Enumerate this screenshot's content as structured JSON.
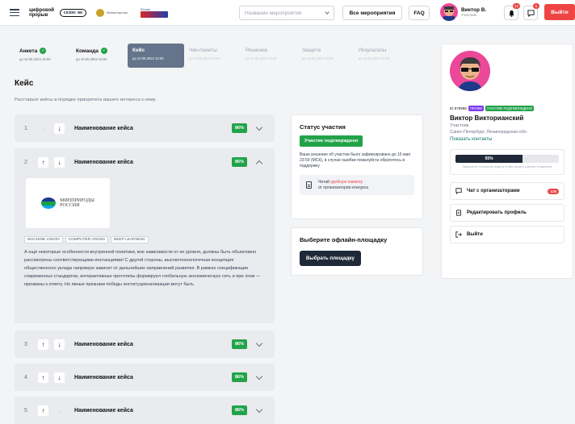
{
  "header": {
    "logo_text_1": "цифровой",
    "logo_text_2": "прорыв",
    "season_label": "сезон: ии",
    "partner_1_text": "Министерство",
    "partner_2_text": "Россия",
    "event_select_placeholder": "Название мероприятия",
    "all_events_label": "Все мероприятия",
    "faq_label": "FAQ",
    "user_name": "Виктор В.",
    "user_role": "Участник",
    "bell_count": "12",
    "chat_count": "5",
    "logout_label": "Выйти"
  },
  "steps": [
    {
      "title": "Анкета",
      "date": "до 10.05.2024 10:00",
      "state": "done"
    },
    {
      "title": "Команда",
      "date": "до 10.05.2024 10:00",
      "state": "done"
    },
    {
      "title": "Кейс",
      "date": "до 10.05.2024 10:00",
      "state": "active"
    },
    {
      "title": "Чек-поинты",
      "date": "до 10.05.2024 10:00",
      "state": "future"
    },
    {
      "title": "Решение",
      "date": "до 10.05.2024 10:00",
      "state": "future"
    },
    {
      "title": "Защита",
      "date": "до 10.05.2024 10:00",
      "state": "future"
    },
    {
      "title": "Результаты",
      "date": "до 10.05.2024 10:00",
      "state": "future"
    }
  ],
  "page": {
    "title": "Кейс",
    "subtitle": "Расставьте кейсы в порядке приоритета вашего интереса к нему"
  },
  "cases": [
    {
      "num": "1",
      "name": "Наименование кейса",
      "pct": "86%",
      "up_enabled": false,
      "down_enabled": true
    },
    {
      "num": "2",
      "name": "Наименование кейса",
      "pct": "86%",
      "up_enabled": true,
      "down_enabled": true,
      "expanded": true,
      "org_logo_text_1": "МИНПРИРОДЫ",
      "org_logo_text_2": "РОССИИ",
      "tags": [
        "MACHINE VISION",
        "COMPUTER VISION",
        "DEEP LEARNING"
      ],
      "description": "А ещё некоторые особенности внутренней политики, вне зависимости от их уровня, должны быть объективно рассмотрены соответствующими инстанциями! С другой стороны, высокотехнологичная концепция общественного уклада напрямую зависит от дальнейших направлений развития. В рамках спецификации современных стандартов, интерактивные прототипы формируют глобальную экономическую сеть и при этом — призваны к ответу. Но явные признаки победы институционализации могут быть"
    },
    {
      "num": "3",
      "name": "Наименование кейса",
      "pct": "86%",
      "up_enabled": true,
      "down_enabled": true
    },
    {
      "num": "4",
      "name": "Наименование кейса",
      "pct": "86%",
      "up_enabled": true,
      "down_enabled": true
    },
    {
      "num": "5",
      "name": "Наименование кейса",
      "pct": "86%",
      "up_enabled": true,
      "down_enabled": false
    }
  ],
  "status_card": {
    "title": "Статус участия",
    "confirm_label": "Участие подтверждено",
    "note": "Ваше решение об участии было зафиксировано до 16 мая 23:59 (МСК), в случае ошибки пожалуйста обратитесь в поддержку",
    "memo_prefix": "Читай",
    "memo_link": "удобную памятку",
    "memo_suffix": "от организаторов конкурса"
  },
  "venue_card": {
    "title": "Выберите офлайн-площадку",
    "button_label": "Выбрать площадку"
  },
  "profile": {
    "id_label": "ID 878998",
    "badge_pro": "ПРОФИ",
    "badge_confirmed": "УЧАСТИЕ ПОДТВЕРЖДЕНО",
    "name": "Виктор Викторианский",
    "role": "Участник",
    "city": "Санкт-Петербург, Ленинградская обл.",
    "contacts_label": "Показать контакты",
    "progress_label": "65%",
    "progress_value": 0.65,
    "progress_note": "Заполните полностью анкету чтобы начать участие в хакатоне",
    "menu": [
      {
        "label": "Чат с организаторами",
        "count": "125"
      },
      {
        "label": "Редактировать профиль"
      },
      {
        "label": "Выйти"
      }
    ]
  },
  "colors": {
    "accent_green": "#22a34a",
    "danger_red": "#ef4444",
    "active_step": "#64748b",
    "dark_button": "#1f2937",
    "badge_purple": "#7c3aed"
  }
}
